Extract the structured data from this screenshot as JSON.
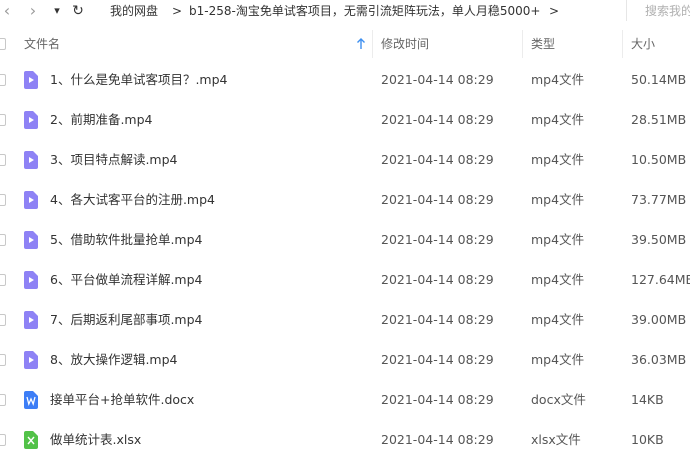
{
  "nav": {
    "back_glyph": "‹",
    "forward_glyph": "›",
    "dropdown_glyph": "▾",
    "refresh_glyph": "↻"
  },
  "breadcrumb": {
    "items": [
      "我的网盘",
      "b1-258-淘宝免单试客项目，无需引流矩阵玩法，单人月稳5000+"
    ],
    "separator": ">"
  },
  "search": {
    "placeholder": "搜索我的"
  },
  "columns": {
    "name": "文件名",
    "modified": "修改时间",
    "type": "类型",
    "size": "大小"
  },
  "colors": {
    "video_icon": "#8e82f5",
    "word_icon": "#3d7ef6",
    "excel_icon": "#52c248",
    "sort_arrow": "#3d8ff0"
  },
  "files": [
    {
      "name": "1、什么是免单试客项目？.mp4",
      "modified": "2021-04-14 08:29",
      "type": "mp4文件",
      "size": "50.14MB",
      "icon": "video-icon"
    },
    {
      "name": "2、前期准备.mp4",
      "modified": "2021-04-14 08:29",
      "type": "mp4文件",
      "size": "28.51MB",
      "icon": "video-icon"
    },
    {
      "name": "3、项目特点解读.mp4",
      "modified": "2021-04-14 08:29",
      "type": "mp4文件",
      "size": "10.50MB",
      "icon": "video-icon"
    },
    {
      "name": "4、各大试客平台的注册.mp4",
      "modified": "2021-04-14 08:29",
      "type": "mp4文件",
      "size": "73.77MB",
      "icon": "video-icon"
    },
    {
      "name": "5、借助软件批量抢单.mp4",
      "modified": "2021-04-14 08:29",
      "type": "mp4文件",
      "size": "39.50MB",
      "icon": "video-icon"
    },
    {
      "name": "6、平台做单流程详解.mp4",
      "modified": "2021-04-14 08:29",
      "type": "mp4文件",
      "size": "127.64MB",
      "icon": "video-icon"
    },
    {
      "name": "7、后期返利尾部事项.mp4",
      "modified": "2021-04-14 08:29",
      "type": "mp4文件",
      "size": "39.00MB",
      "icon": "video-icon"
    },
    {
      "name": "8、放大操作逻辑.mp4",
      "modified": "2021-04-14 08:29",
      "type": "mp4文件",
      "size": "36.03MB",
      "icon": "video-icon"
    },
    {
      "name": "接单平台+抢单软件.docx",
      "modified": "2021-04-14 08:29",
      "type": "docx文件",
      "size": "14KB",
      "icon": "word-icon"
    },
    {
      "name": "做单统计表.xlsx",
      "modified": "2021-04-14 08:29",
      "type": "xlsx文件",
      "size": "10KB",
      "icon": "excel-icon"
    }
  ]
}
